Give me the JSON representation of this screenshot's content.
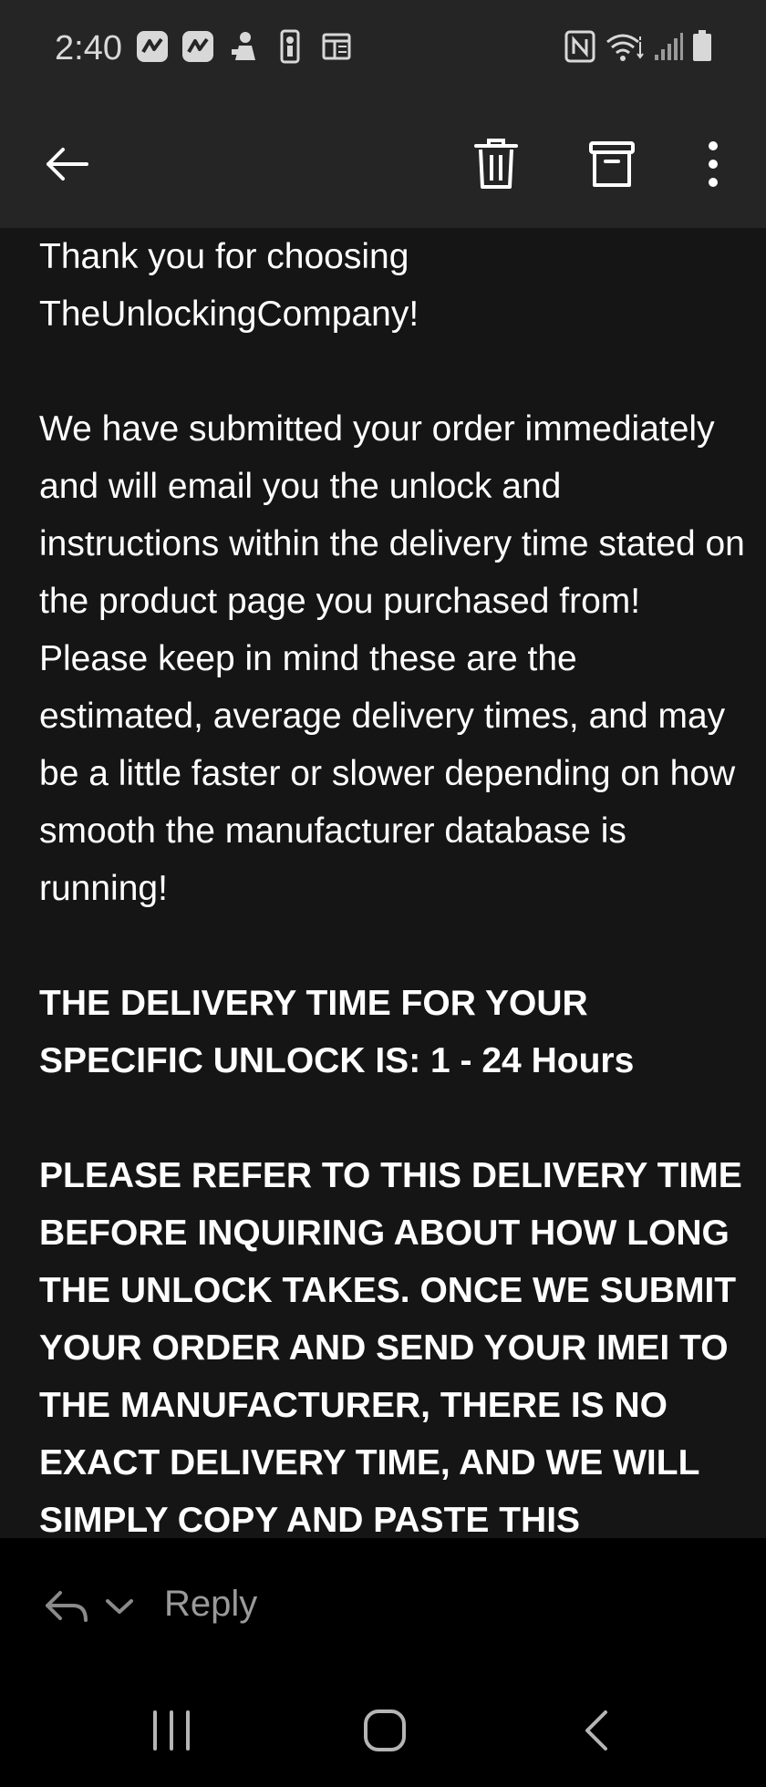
{
  "status_bar": {
    "time": "2:40",
    "left_icons": [
      "app-notification-icon",
      "app-notification-icon",
      "game-character-icon",
      "sports-app-icon",
      "news-app-icon"
    ],
    "right_icons": [
      "nfc-icon",
      "wifi-icon",
      "signal-icon",
      "battery-icon"
    ]
  },
  "app_bar": {
    "icons": [
      "back-arrow-icon",
      "trash-icon",
      "archive-icon",
      "more-vert-icon"
    ]
  },
  "email": {
    "paragraph_1": "Thank you for choosing TheUnlockingCompany!",
    "paragraph_2": "We have submitted your order immediately and will email you the unlock and instructions within the delivery time stated on the product page you purchased from! Please keep in mind these are the estimated, average delivery times, and may be a little faster or slower depending on how smooth the manufacturer database is running!",
    "paragraph_3": "THE DELIVERY TIME FOR YOUR SPECIFIC UNLOCK IS: 1 - 24 Hours",
    "paragraph_4": "PLEASE REFER TO THIS DELIVERY TIME BEFORE INQUIRING ABOUT HOW LONG THE UNLOCK TAKES. ONCE WE SUBMIT YOUR ORDER AND SEND YOUR IMEI TO THE MANUFACTURER, THERE IS NO EXACT DELIVERY TIME, AND WE WILL SIMPLY COPY AND PASTE THIS"
  },
  "reply_bar": {
    "reply_label": "Reply"
  },
  "nav_bar": {
    "icons": [
      "recent-apps-icon",
      "home-icon",
      "back-nav-icon"
    ]
  }
}
